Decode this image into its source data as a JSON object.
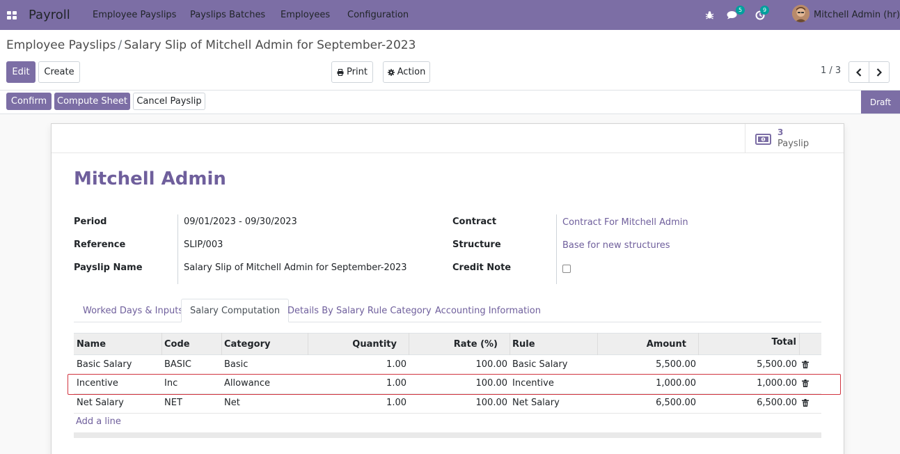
{
  "navbar": {
    "app_name": "Payroll",
    "menu": [
      "Employee Payslips",
      "Payslips Batches",
      "Employees",
      "Configuration"
    ],
    "messages_count": "5",
    "activities_count": "9",
    "user_name": "Mitchell Admin (hr)",
    "icons": [
      "apps-grid-icon",
      "bug-icon",
      "chat-icon",
      "clock-icon"
    ]
  },
  "breadcrumb": {
    "parent": "Employee Payslips",
    "separator": "/",
    "current": "Salary Slip of Mitchell Admin for September-2023"
  },
  "toolbar": {
    "edit": "Edit",
    "create": "Create",
    "print": "Print",
    "action": "Action",
    "pager": "1 / 3"
  },
  "statusbar": {
    "confirm": "Confirm",
    "compute_sheet": "Compute Sheet",
    "cancel_payslip": "Cancel Payslip",
    "state": "Draft"
  },
  "smart_button": {
    "value": "3",
    "label": "Payslip"
  },
  "form": {
    "employee": "Mitchell Admin",
    "period_label": "Period",
    "period": "09/01/2023 - 09/30/2023",
    "reference_label": "Reference",
    "reference": "SLIP/003",
    "payslip_name_label": "Payslip Name",
    "payslip_name": "Salary Slip of Mitchell Admin for September-2023",
    "contract_label": "Contract",
    "contract": "Contract For Mitchell Admin",
    "structure_label": "Structure",
    "structure": "Base for new structures",
    "credit_note_label": "Credit Note",
    "credit_note": false
  },
  "tabs": [
    {
      "label": "Worked Days & Inputs"
    },
    {
      "label": "Salary Computation"
    },
    {
      "label": "Details By Salary Rule Category"
    },
    {
      "label": "Accounting Information"
    }
  ],
  "table": {
    "headers": [
      "Name",
      "Code",
      "Category",
      "Quantity",
      "Rate (%)",
      "Rule",
      "Amount",
      "Total"
    ],
    "rows": [
      [
        "Basic Salary",
        "BASIC",
        "Basic",
        "1.00",
        "100.00",
        "Basic Salary",
        "5,500.00",
        "5,500.00"
      ],
      [
        "Incentive",
        "Inc",
        "Allowance",
        "1.00",
        "100.00",
        "Incentive",
        "1,000.00",
        "1,000.00"
      ],
      [
        "Net Salary",
        "NET",
        "Net",
        "1.00",
        "100.00",
        "Net Salary",
        "6,500.00",
        "6,500.00"
      ]
    ],
    "add_line": "Add a line"
  },
  "colors": {
    "brand": "#7c6ea5",
    "link": "#6f5f9c",
    "badge": "#00a09d",
    "highlight": "#d0333f"
  }
}
